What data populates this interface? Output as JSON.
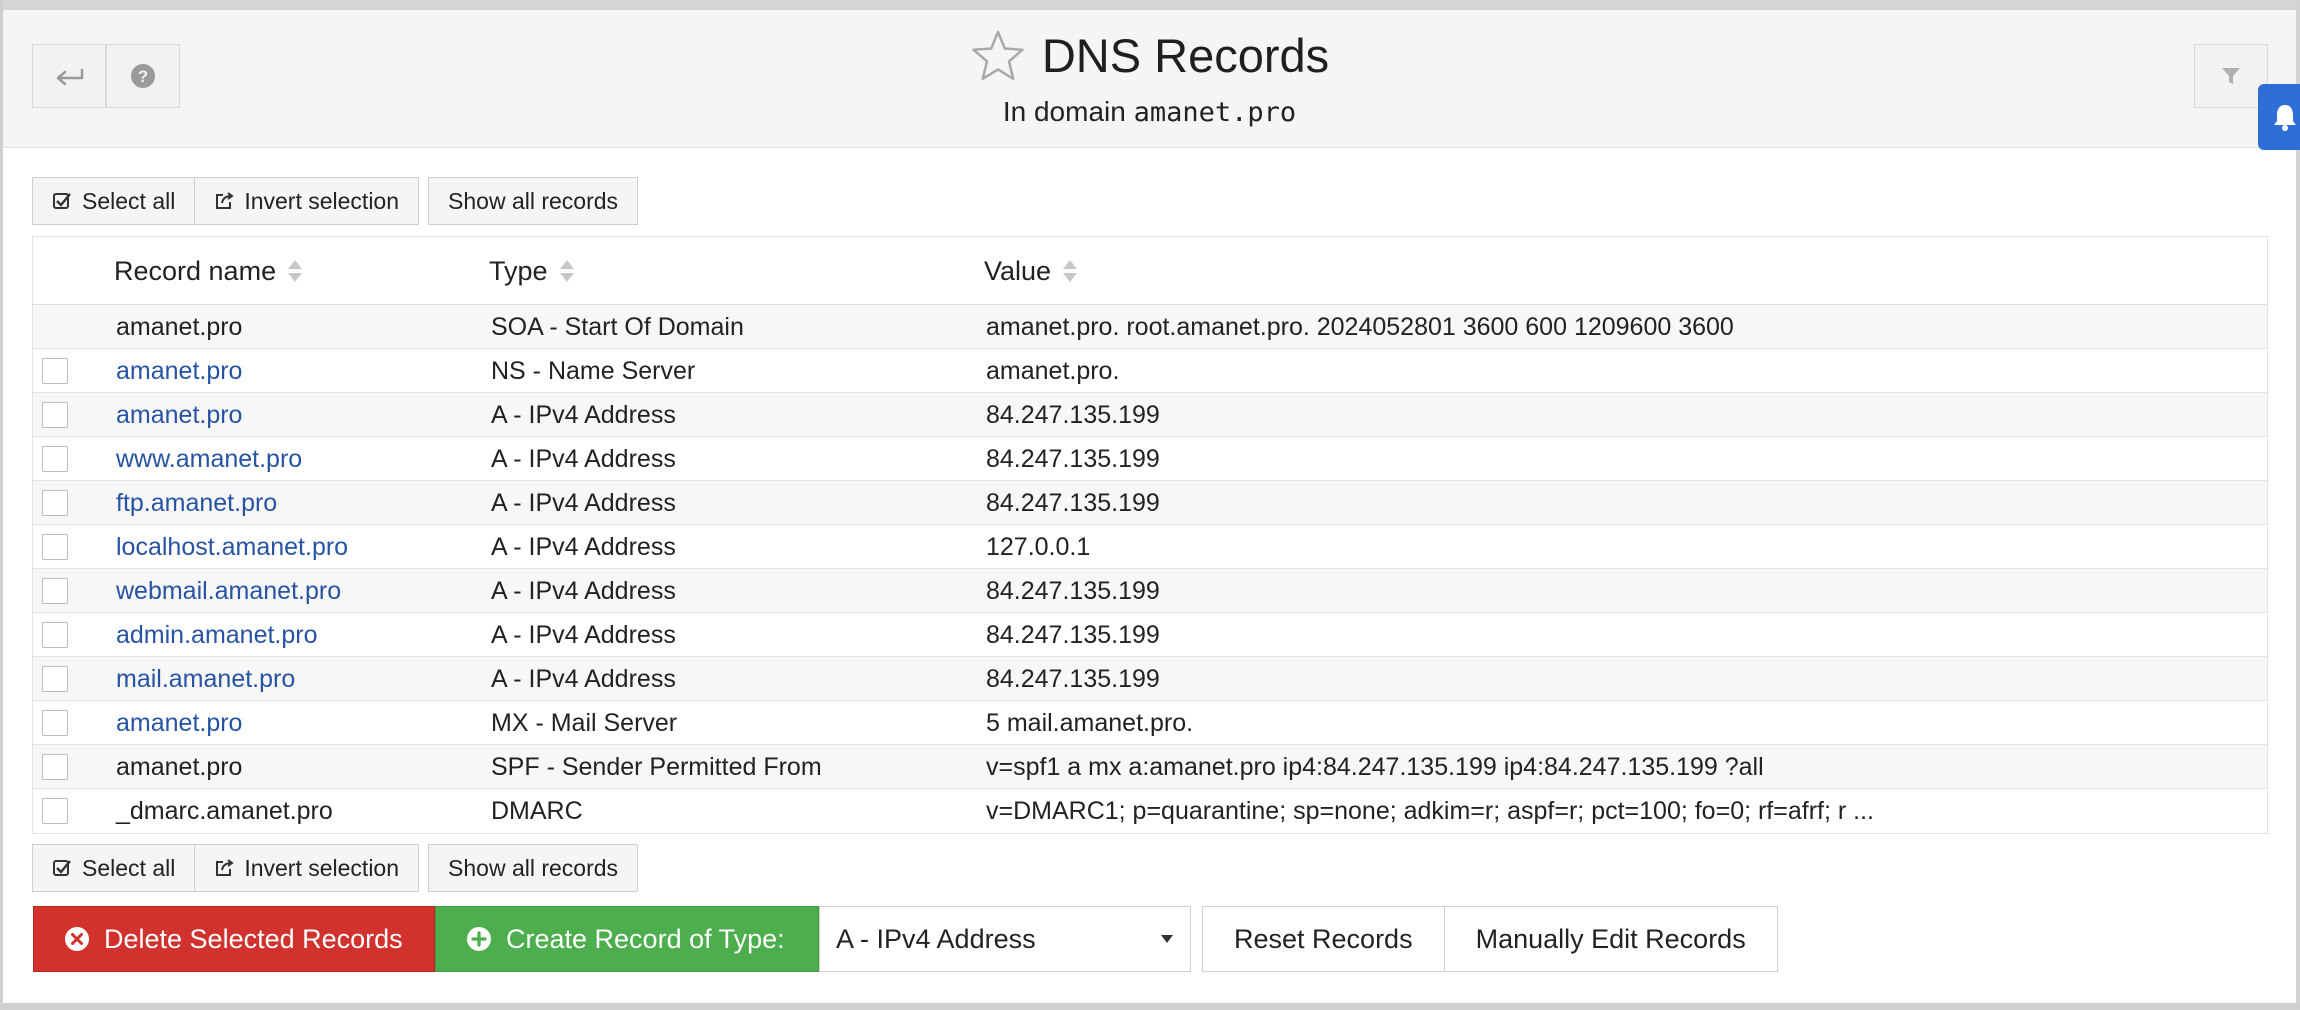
{
  "header": {
    "title": "DNS Records",
    "subtitle_prefix": "In domain ",
    "domain": "amanet.pro"
  },
  "toolbar": {
    "select_all": "Select all",
    "invert_selection": "Invert selection",
    "show_all_records": "Show all records"
  },
  "table": {
    "columns": [
      "Record name",
      "Type",
      "Value"
    ],
    "rows": [
      {
        "name": "amanet.pro",
        "type": "SOA - Start Of Domain",
        "value": "amanet.pro. root.amanet.pro. 2024052801 3600 600 1209600 3600"
      },
      {
        "name": "amanet.pro",
        "type": "NS - Name Server",
        "value": "amanet.pro."
      },
      {
        "name": "amanet.pro",
        "type": "A - IPv4 Address",
        "value": "84.247.135.199"
      },
      {
        "name": "www.amanet.pro",
        "type": "A - IPv4 Address",
        "value": "84.247.135.199"
      },
      {
        "name": "ftp.amanet.pro",
        "type": "A - IPv4 Address",
        "value": "84.247.135.199"
      },
      {
        "name": "localhost.amanet.pro",
        "type": "A - IPv4 Address",
        "value": "127.0.0.1"
      },
      {
        "name": "webmail.amanet.pro",
        "type": "A - IPv4 Address",
        "value": "84.247.135.199"
      },
      {
        "name": "admin.amanet.pro",
        "type": "A - IPv4 Address",
        "value": "84.247.135.199"
      },
      {
        "name": "mail.amanet.pro",
        "type": "A - IPv4 Address",
        "value": "84.247.135.199"
      },
      {
        "name": "amanet.pro",
        "type": "MX - Mail Server",
        "value": "5 mail.amanet.pro."
      },
      {
        "name": "amanet.pro",
        "type": "SPF - Sender Permitted From",
        "value": "v=spf1 a mx a:amanet.pro ip4:84.247.135.199 ip4:84.247.135.199 ?all"
      },
      {
        "name": "_dmarc.amanet.pro",
        "type": "DMARC",
        "value": "v=DMARC1; p=quarantine; sp=none; adkim=r; aspf=r; pct=100; fo=0; rf=afrf; r ..."
      }
    ]
  },
  "actions": {
    "delete": "Delete Selected Records",
    "create": "Create Record of Type:",
    "record_type": "A - IPv4 Address",
    "reset": "Reset Records",
    "manual_edit": "Manually Edit Records"
  },
  "colors": {
    "link": "#2653a3",
    "danger": "#d2322d",
    "success": "#4cae4c",
    "accent_tab": "#2f6ed6"
  }
}
